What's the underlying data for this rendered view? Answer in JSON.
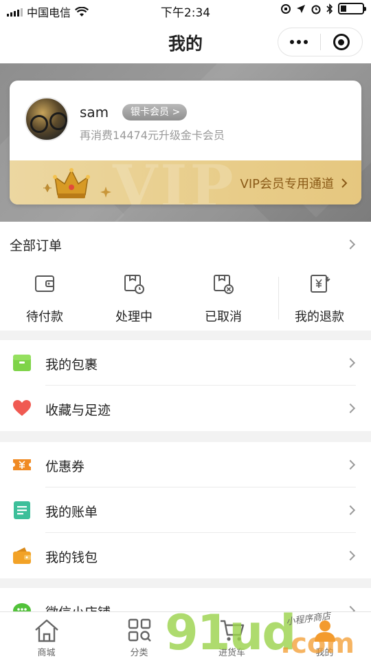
{
  "status_bar": {
    "carrier": "中国电信",
    "time": "下午2:34"
  },
  "nav": {
    "title": "我的"
  },
  "member": {
    "username": "sam",
    "badge": "银卡会员 >",
    "upgrade_hint": "再消费14474元升级金卡会员",
    "vip_watermark": "VIP",
    "vip_entry": "VIP会员专用通道"
  },
  "orders": {
    "title": "全部订单",
    "items": [
      {
        "label": "待付款",
        "icon": "wallet-icon"
      },
      {
        "label": "处理中",
        "icon": "processing-icon"
      },
      {
        "label": "已取消",
        "icon": "cancelled-icon"
      },
      {
        "label": "我的退款",
        "icon": "refund-icon"
      }
    ]
  },
  "list_a": [
    {
      "label": "我的包裹",
      "icon": "package-icon",
      "color": "#7ed348"
    },
    {
      "label": "收藏与足迹",
      "icon": "heart-icon",
      "color": "#f05a52"
    }
  ],
  "list_b": [
    {
      "label": "优惠券",
      "icon": "coupon-icon",
      "color": "#f08a24"
    },
    {
      "label": "我的账单",
      "icon": "bill-icon",
      "color": "#3dbf9a"
    },
    {
      "label": "我的钱包",
      "icon": "wallet-color-icon",
      "color": "#f2a227"
    }
  ],
  "list_c": [
    {
      "label": "微信小店铺",
      "icon": "wechat-icon",
      "color": "#52c23a"
    }
  ],
  "tabs": [
    {
      "label": "商城",
      "icon": "home-icon"
    },
    {
      "label": "分类",
      "icon": "category-icon"
    },
    {
      "label": "进货车",
      "icon": "cart-icon"
    },
    {
      "label": "我的",
      "icon": "person-icon"
    }
  ],
  "watermark": {
    "brand": "91ud",
    "domain": ".com",
    "caption": "小程序商店"
  }
}
